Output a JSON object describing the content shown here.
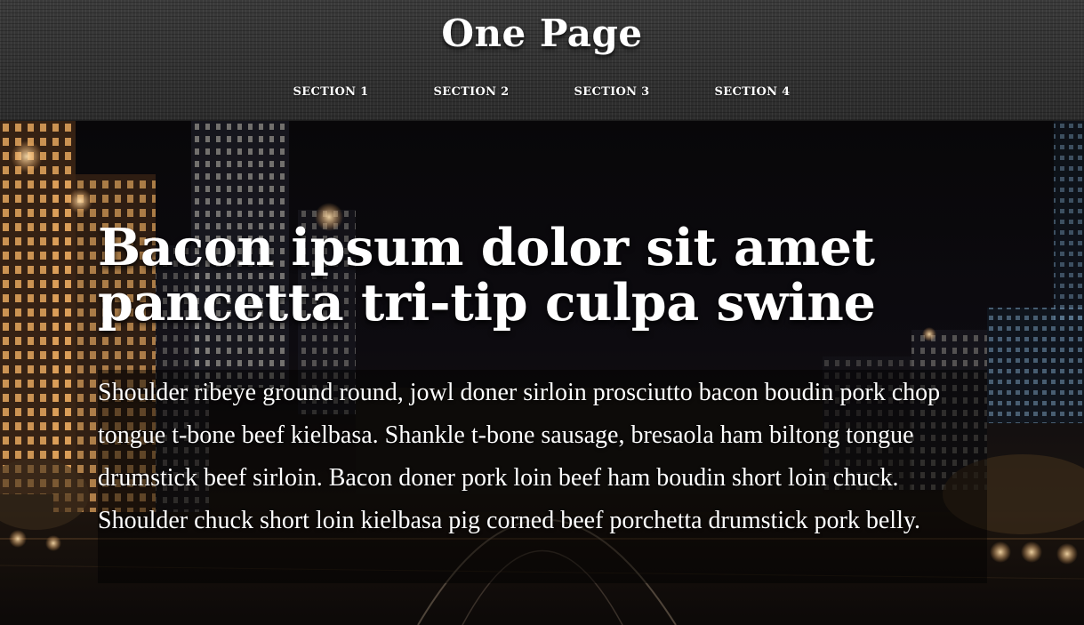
{
  "header": {
    "title": "One Page",
    "nav": [
      "SECTION 1",
      "SECTION 2",
      "SECTION 3",
      "SECTION 4"
    ]
  },
  "hero": {
    "heading": "Bacon ipsum dolor sit amet pancetta tri-tip culpa swine",
    "body": "Shoulder ribeye ground round, jowl doner sirloin prosciutto bacon boudin pork chop tongue t-bone beef kielbasa. Shankle t-bone sausage, bresaola ham biltong tongue drumstick beef sirloin. Bacon doner pork loin beef ham boudin short loin chuck. Shoulder chuck short loin kielbasa pig corned beef porchetta drumstick pork belly."
  },
  "colors": {
    "header_bg": "#333333",
    "text": "#ffffff",
    "hero_bg": "#0b0a0d"
  }
}
